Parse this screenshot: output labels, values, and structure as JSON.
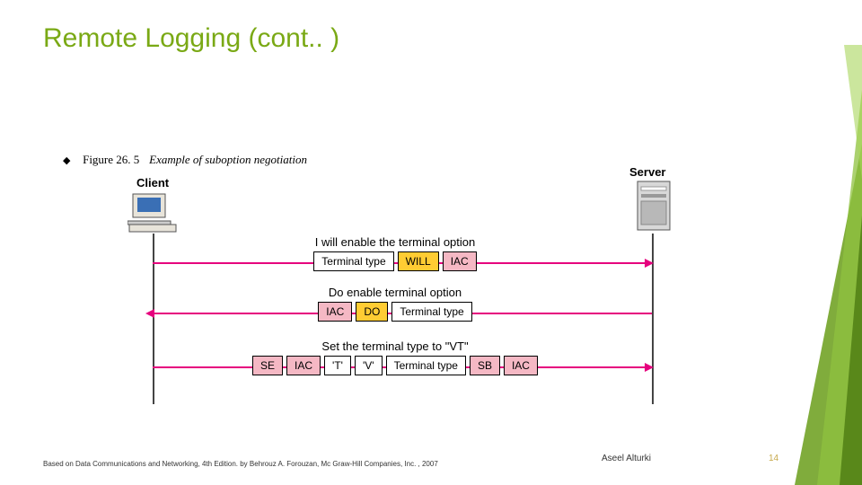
{
  "title": "Remote Logging (cont.. )",
  "figure": {
    "label": "Figure 26. 5",
    "caption": "Example of suboption negotiation"
  },
  "labels": {
    "client": "Client",
    "server": "Server"
  },
  "rows": [
    {
      "caption": "I will enable the terminal option",
      "dir": "right",
      "blocks": [
        {
          "text": "Terminal type",
          "cls": ""
        },
        {
          "text": "WILL",
          "cls": "yellow"
        },
        {
          "text": "IAC",
          "cls": "pink"
        }
      ]
    },
    {
      "caption": "Do enable terminal option",
      "dir": "left",
      "blocks": [
        {
          "text": "IAC",
          "cls": "pink"
        },
        {
          "text": "DO",
          "cls": "yellow"
        },
        {
          "text": "Terminal type",
          "cls": ""
        }
      ]
    },
    {
      "caption": "Set the terminal type to \"VT\"",
      "dir": "right",
      "blocks": [
        {
          "text": "SE",
          "cls": "pink"
        },
        {
          "text": "IAC",
          "cls": "pink"
        },
        {
          "text": "'T'",
          "cls": ""
        },
        {
          "text": "'V'",
          "cls": ""
        },
        {
          "text": "Terminal type",
          "cls": ""
        },
        {
          "text": "SB",
          "cls": "pink"
        },
        {
          "text": "IAC",
          "cls": "pink"
        }
      ]
    }
  ],
  "footer": "Based on Data Communications and Networking, 4th Edition. by Behrouz A. Forouzan,   Mc Graw-Hill Companies, Inc. , 2007",
  "author": "Aseel Alturki",
  "page": "14"
}
